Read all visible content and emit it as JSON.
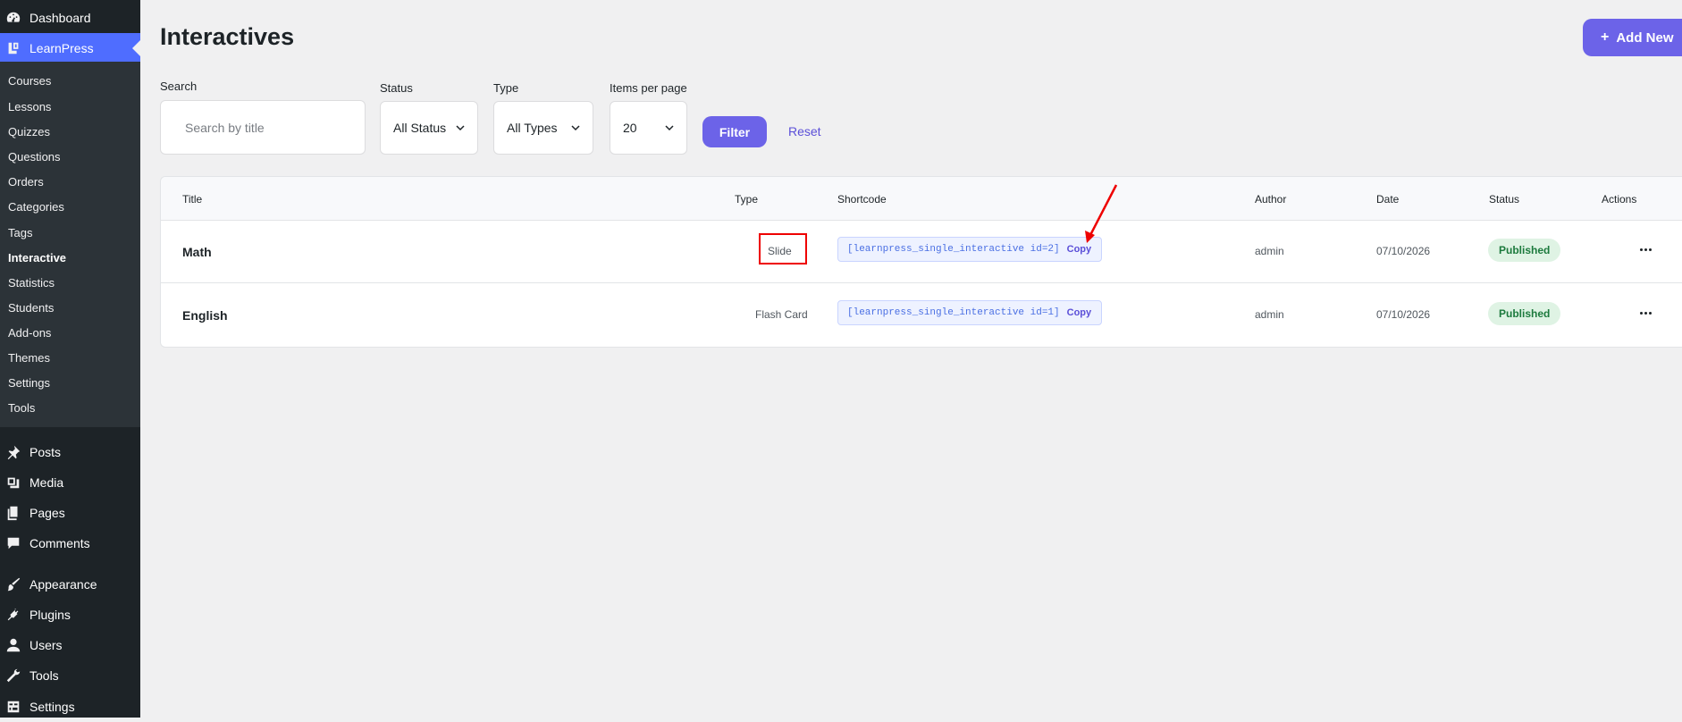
{
  "sidebar": {
    "top": [
      {
        "label": "Dashboard",
        "icon": "dashboard-icon"
      },
      {
        "label": "LearnPress",
        "icon": "learnpress-icon"
      }
    ],
    "learnpress_submenu": [
      "Courses",
      "Lessons",
      "Quizzes",
      "Questions",
      "Orders",
      "Categories",
      "Tags",
      "Interactive",
      "Statistics",
      "Students",
      "Add-ons",
      "Themes",
      "Settings",
      "Tools"
    ],
    "current_submenu": "Interactive",
    "bottom": [
      {
        "label": "Posts",
        "icon": "pin-icon"
      },
      {
        "label": "Media",
        "icon": "media-icon"
      },
      {
        "label": "Pages",
        "icon": "pages-icon"
      },
      {
        "label": "Comments",
        "icon": "comment-icon"
      },
      {
        "label": "Appearance",
        "icon": "brush-icon"
      },
      {
        "label": "Plugins",
        "icon": "plug-icon"
      },
      {
        "label": "Users",
        "icon": "user-icon"
      },
      {
        "label": "Tools",
        "icon": "wrench-icon"
      },
      {
        "label": "Settings",
        "icon": "settings-icon"
      }
    ]
  },
  "page": {
    "title": "Interactives",
    "add_new_label": "Add New"
  },
  "filters": {
    "search_label": "Search",
    "search_placeholder": "Search by title",
    "status_label": "Status",
    "status_value": "All Status",
    "type_label": "Type",
    "type_value": "All Types",
    "per_page_label": "Items per page",
    "per_page_value": "20",
    "filter_label": "Filter",
    "reset_label": "Reset"
  },
  "table": {
    "headers": [
      "Title",
      "Type",
      "Shortcode",
      "Author",
      "Date",
      "Status",
      "Actions"
    ],
    "rows": [
      {
        "title": "Math",
        "type": "Slide",
        "shortcode": "[learnpress_single_interactive id=2]",
        "copy": "Copy",
        "author": "admin",
        "date": "07/10/2026",
        "status": "Published"
      },
      {
        "title": "English",
        "type": "Flash Card",
        "shortcode": "[learnpress_single_interactive id=1]",
        "copy": "Copy",
        "author": "admin",
        "date": "07/10/2026",
        "status": "Published"
      }
    ]
  },
  "colors": {
    "accent": "#6c63e8",
    "sidebar_bg": "#1d2327",
    "active_menu": "#4f6dff",
    "annotation": "#e00000"
  }
}
